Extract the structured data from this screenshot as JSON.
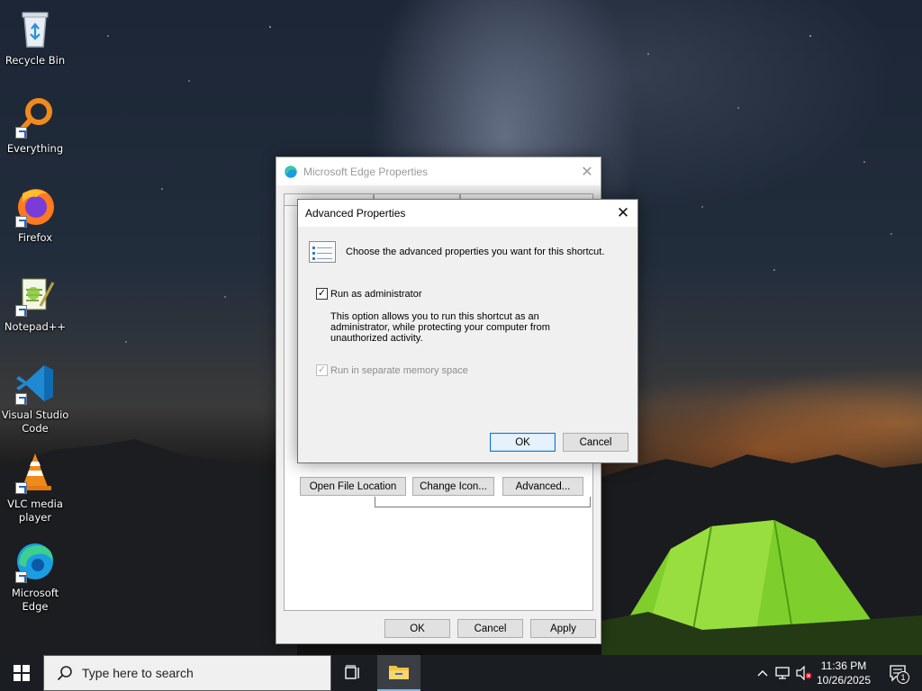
{
  "desktop": {
    "icons": [
      {
        "label": "Recycle Bin",
        "icon": "recycle-bin-icon"
      },
      {
        "label": "Everything",
        "icon": "everything-search-icon"
      },
      {
        "label": "Firefox",
        "icon": "firefox-icon"
      },
      {
        "label": "Notepad++",
        "icon": "notepad-plus-plus-icon"
      },
      {
        "label": "Visual Studio Code",
        "icon": "vscode-icon"
      },
      {
        "label": "VLC media player",
        "icon": "vlc-icon"
      },
      {
        "label": "Microsoft Edge",
        "icon": "edge-icon"
      }
    ]
  },
  "properties_window": {
    "title": "Microsoft Edge Properties",
    "buttons": {
      "open_file_location": "Open File Location",
      "change_icon": "Change Icon...",
      "advanced": "Advanced...",
      "ok": "OK",
      "cancel": "Cancel",
      "apply": "Apply"
    }
  },
  "advanced_dialog": {
    "title": "Advanced Properties",
    "prompt": "Choose the advanced properties you want for this shortcut.",
    "run_as_admin": {
      "label": "Run as administrator",
      "checked": true
    },
    "description": "This option allows you to run this shortcut as an administrator, while protecting your computer from unauthorized activity.",
    "separate_memory": {
      "label": "Run in separate memory space",
      "checked": true,
      "disabled": true
    },
    "ok_label": "OK",
    "cancel_label": "Cancel"
  },
  "taskbar": {
    "search_placeholder": "Type here to search",
    "time": "11:36 PM",
    "date": "10/26/2025",
    "notification_count": "1"
  },
  "colors": {
    "accent": "#0078d7",
    "taskbar": "#1a1d22",
    "dialog_bg": "#f0f0f0"
  }
}
